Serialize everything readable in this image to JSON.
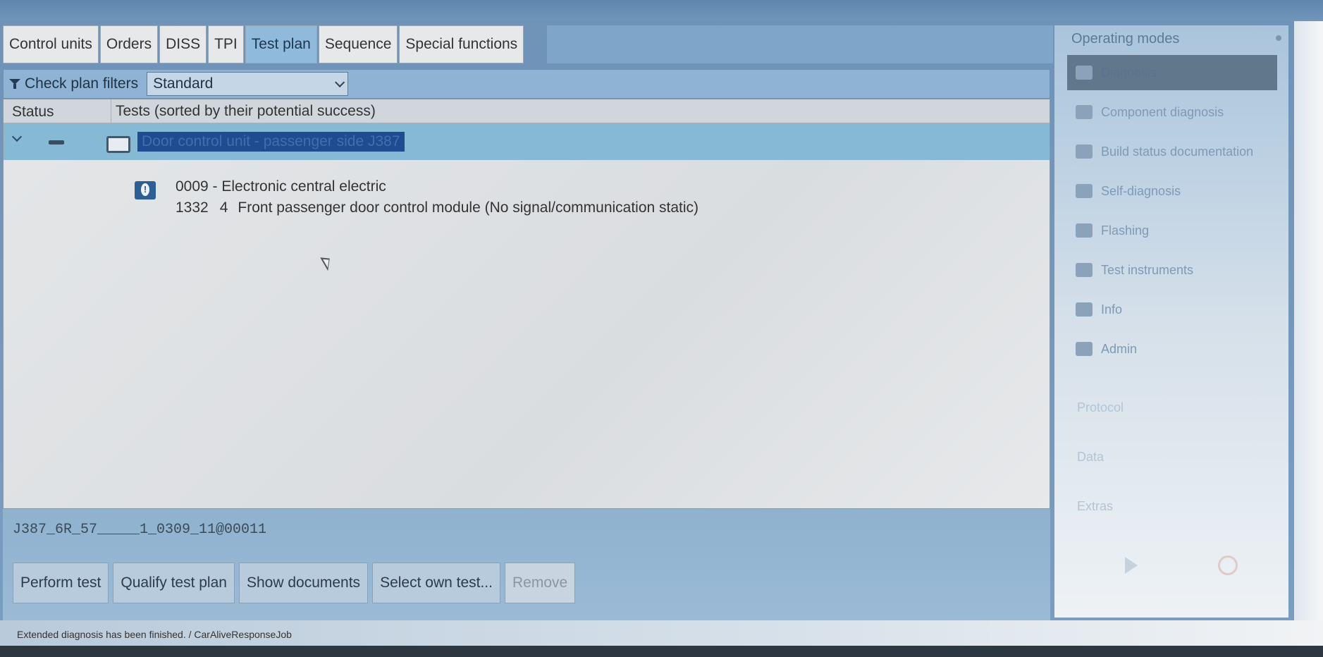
{
  "tabs": [
    {
      "label": "Control units",
      "active": false
    },
    {
      "label": "Orders",
      "active": false
    },
    {
      "label": "DISS",
      "active": false
    },
    {
      "label": "TPI",
      "active": false
    },
    {
      "label": "Test plan",
      "active": true
    },
    {
      "label": "Sequence",
      "active": false
    },
    {
      "label": "Special functions",
      "active": false
    }
  ],
  "filter": {
    "button_label": "Check plan filters",
    "selected": "Standard"
  },
  "table": {
    "col_status": "Status",
    "col_tests": "Tests (sorted by their potential success)",
    "selected_row_title": "Door control unit - passenger side J387"
  },
  "entry": {
    "line1": "0009 - Electronic central electric",
    "code": "1332",
    "num": "4",
    "desc": "Front passenger door control module  (No signal/communication   static)"
  },
  "code_line": "J387_6R_57_____1_0309_11@00011",
  "buttons": {
    "perform": "Perform test",
    "qualify": "Qualify test plan",
    "show_docs": "Show documents",
    "select_own": "Select own test...",
    "remove": "Remove"
  },
  "status_text": "Extended diagnosis has been finished. / CarAliveResponseJob",
  "operating_modes": {
    "header": "Operating modes",
    "items": [
      "Diagnosis",
      "Component diagnosis",
      "Build status documentation",
      "Self-diagnosis",
      "Flashing",
      "Test instruments",
      "Info",
      "Admin"
    ],
    "plain": [
      "Protocol",
      "Data",
      "Extras"
    ]
  }
}
